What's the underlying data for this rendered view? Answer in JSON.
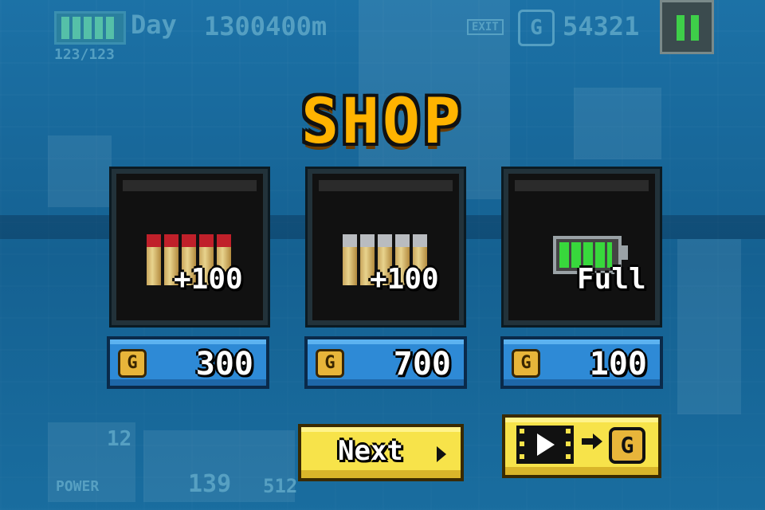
{
  "hud": {
    "day_label": "Day",
    "distance": "1300400m",
    "hp_text": "123/123",
    "exit_label": "EXIT",
    "gold": "54321",
    "power_label": "POWER",
    "power_count": "12",
    "ammo_count_1": "139",
    "ammo_count_2": "512"
  },
  "title": "SHOP",
  "items": [
    {
      "icon": "red-shells-icon",
      "label": "+100",
      "price": "300"
    },
    {
      "icon": "silver-shells-icon",
      "label": "+100",
      "price": "700"
    },
    {
      "icon": "battery-icon",
      "label": "Full",
      "price": "100"
    }
  ],
  "coin_symbol": "G",
  "buttons": {
    "next": "Next"
  },
  "colors": {
    "title": "#ffb300",
    "price_button": "#2e8ad6",
    "action_button": "#f7e34a",
    "battery_cell": "#38d83c",
    "pause_bars": "#3ecf49"
  }
}
